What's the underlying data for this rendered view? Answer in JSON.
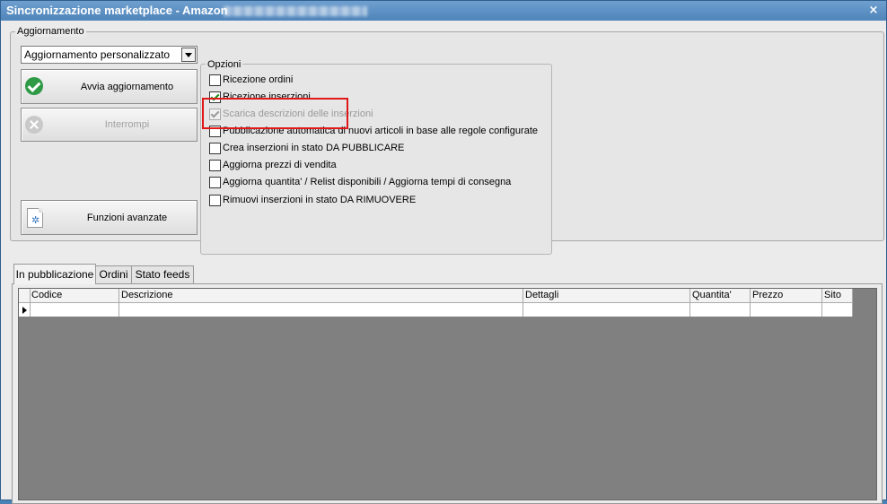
{
  "window": {
    "title": "Sincronizzazione marketplace - Amazon",
    "close_glyph": "×"
  },
  "update_group": {
    "legend": "Aggiornamento",
    "mode_select": {
      "value": "Aggiornamento personalizzato"
    },
    "start_button": {
      "label": "Avvia aggiornamento",
      "icon": "check-circle-icon"
    },
    "stop_button": {
      "label": "Interrompi",
      "icon": "x-circle-icon",
      "disabled": true
    },
    "advanced_button": {
      "label": "Funzioni avanzate",
      "icon": "document-gear-icon"
    }
  },
  "options_group": {
    "legend": "Opzioni",
    "items": [
      {
        "label": "Ricezione ordini",
        "checked": false,
        "disabled": false
      },
      {
        "label": "Ricezione inserzioni",
        "checked": true,
        "disabled": false
      },
      {
        "label": "Scarica descrizioni delle inserzioni",
        "checked": true,
        "disabled": true
      },
      {
        "label": "Pubblicazione automatica di nuovi articoli in base alle regole configurate",
        "checked": false,
        "disabled": false
      },
      {
        "label": "Crea inserzioni in stato DA PUBBLICARE",
        "checked": false,
        "disabled": false
      },
      {
        "label": "Aggiorna prezzi di vendita",
        "checked": false,
        "disabled": false
      },
      {
        "label": "Aggiorna quantita' / Relist disponibili / Aggiorna tempi di consegna",
        "checked": false,
        "disabled": false
      },
      {
        "label": "Rimuovi inserzioni in stato DA RIMUOVERE",
        "checked": false,
        "disabled": false
      }
    ],
    "highlight_color": "#e01818"
  },
  "tabs": [
    {
      "label": "In pubblicazione",
      "active": true
    },
    {
      "label": "Ordini",
      "active": false
    },
    {
      "label": "Stato feeds",
      "active": false
    }
  ],
  "grid": {
    "columns": [
      "Codice",
      "Descrizione",
      "Dettagli",
      "Quantita'",
      "Prezzo",
      "Sito"
    ]
  }
}
